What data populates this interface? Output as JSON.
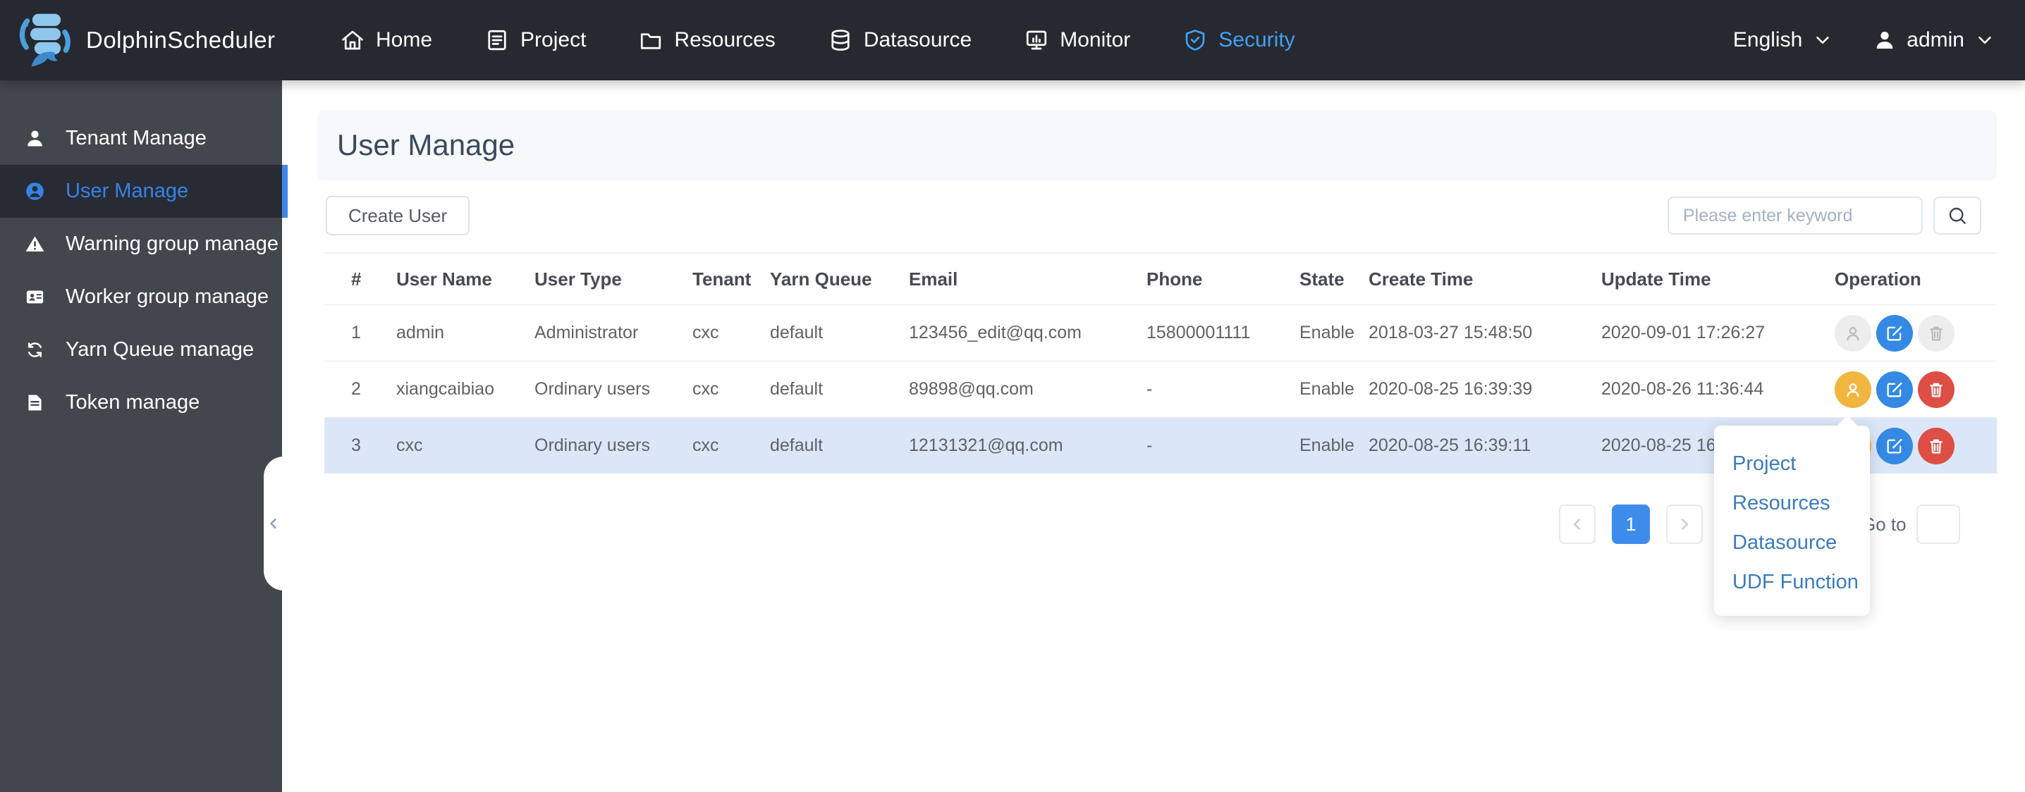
{
  "nav": {
    "brand": "DolphinScheduler",
    "items": [
      {
        "label": "Home",
        "icon": "home-icon",
        "active": false
      },
      {
        "label": "Project",
        "icon": "project-icon",
        "active": false
      },
      {
        "label": "Resources",
        "icon": "folder-icon",
        "active": false
      },
      {
        "label": "Datasource",
        "icon": "database-icon",
        "active": false
      },
      {
        "label": "Monitor",
        "icon": "monitor-icon",
        "active": false
      },
      {
        "label": "Security",
        "icon": "shield-icon",
        "active": true
      }
    ],
    "language": "English",
    "user": "admin"
  },
  "sidebar": {
    "items": [
      {
        "label": "Tenant Manage",
        "icon": "person-icon",
        "active": false
      },
      {
        "label": "User Manage",
        "icon": "user-circle-icon",
        "active": true
      },
      {
        "label": "Warning group manage",
        "icon": "warning-icon",
        "active": false
      },
      {
        "label": "Worker group manage",
        "icon": "id-card-icon",
        "active": false
      },
      {
        "label": "Yarn Queue manage",
        "icon": "recycle-icon",
        "active": false
      },
      {
        "label": "Token manage",
        "icon": "document-icon",
        "active": false
      }
    ]
  },
  "page": {
    "title": "User Manage",
    "create_button": "Create User",
    "search_placeholder": "Please enter keyword"
  },
  "table": {
    "columns": [
      "#",
      "User Name",
      "User Type",
      "Tenant",
      "Yarn Queue",
      "Email",
      "Phone",
      "State",
      "Create Time",
      "Update Time",
      "Operation"
    ],
    "rows": [
      {
        "index": "1",
        "user_name": "admin",
        "user_type": "Administrator",
        "tenant": "cxc",
        "yarn_queue": "default",
        "email": "123456_edit@qq.com",
        "phone": "15800001111",
        "state": "Enable",
        "create_time": "2018-03-27 15:48:50",
        "update_time": "2020-09-01 17:26:27",
        "operations": {
          "authorize": "disabled",
          "edit": "enabled",
          "delete": "disabled"
        },
        "highlighted": false
      },
      {
        "index": "2",
        "user_name": "xiangcaibiao",
        "user_type": "Ordinary users",
        "tenant": "cxc",
        "yarn_queue": "default",
        "email": "89898@qq.com",
        "phone": "-",
        "state": "Enable",
        "create_time": "2020-08-25 16:39:39",
        "update_time": "2020-08-26 11:36:44",
        "operations": {
          "authorize": "enabled",
          "edit": "enabled",
          "delete": "enabled"
        },
        "highlighted": false
      },
      {
        "index": "3",
        "user_name": "cxc",
        "user_type": "Ordinary users",
        "tenant": "cxc",
        "yarn_queue": "default",
        "email": "12131321@qq.com",
        "phone": "-",
        "state": "Enable",
        "create_time": "2020-08-25 16:39:11",
        "update_time": "2020-08-25 16",
        "operations": {
          "authorize": "enabled",
          "edit": "enabled",
          "delete": "enabled"
        },
        "highlighted": true
      }
    ]
  },
  "pagination": {
    "current": "1",
    "goto_label": "Go to"
  },
  "popup": {
    "items": [
      "Project",
      "Resources",
      "Datasource",
      "UDF Function"
    ]
  },
  "colors": {
    "navbar_bg": "#26292f",
    "sidebar_bg": "#42464d",
    "sidebar_active_bg": "#282b33",
    "sidebar_active_text": "#3583e6",
    "nav_active_text": "#42a0f5",
    "row_highlight": "#dbe7f8",
    "authorize_orange": "#f0b63f",
    "edit_blue": "#3389e3",
    "delete_red": "#dd4e45",
    "disabled_grey": "#ededed",
    "popup_link": "#3c7cba",
    "pagination_active": "#3d8ceb",
    "title_text": "#3a4a5c"
  }
}
